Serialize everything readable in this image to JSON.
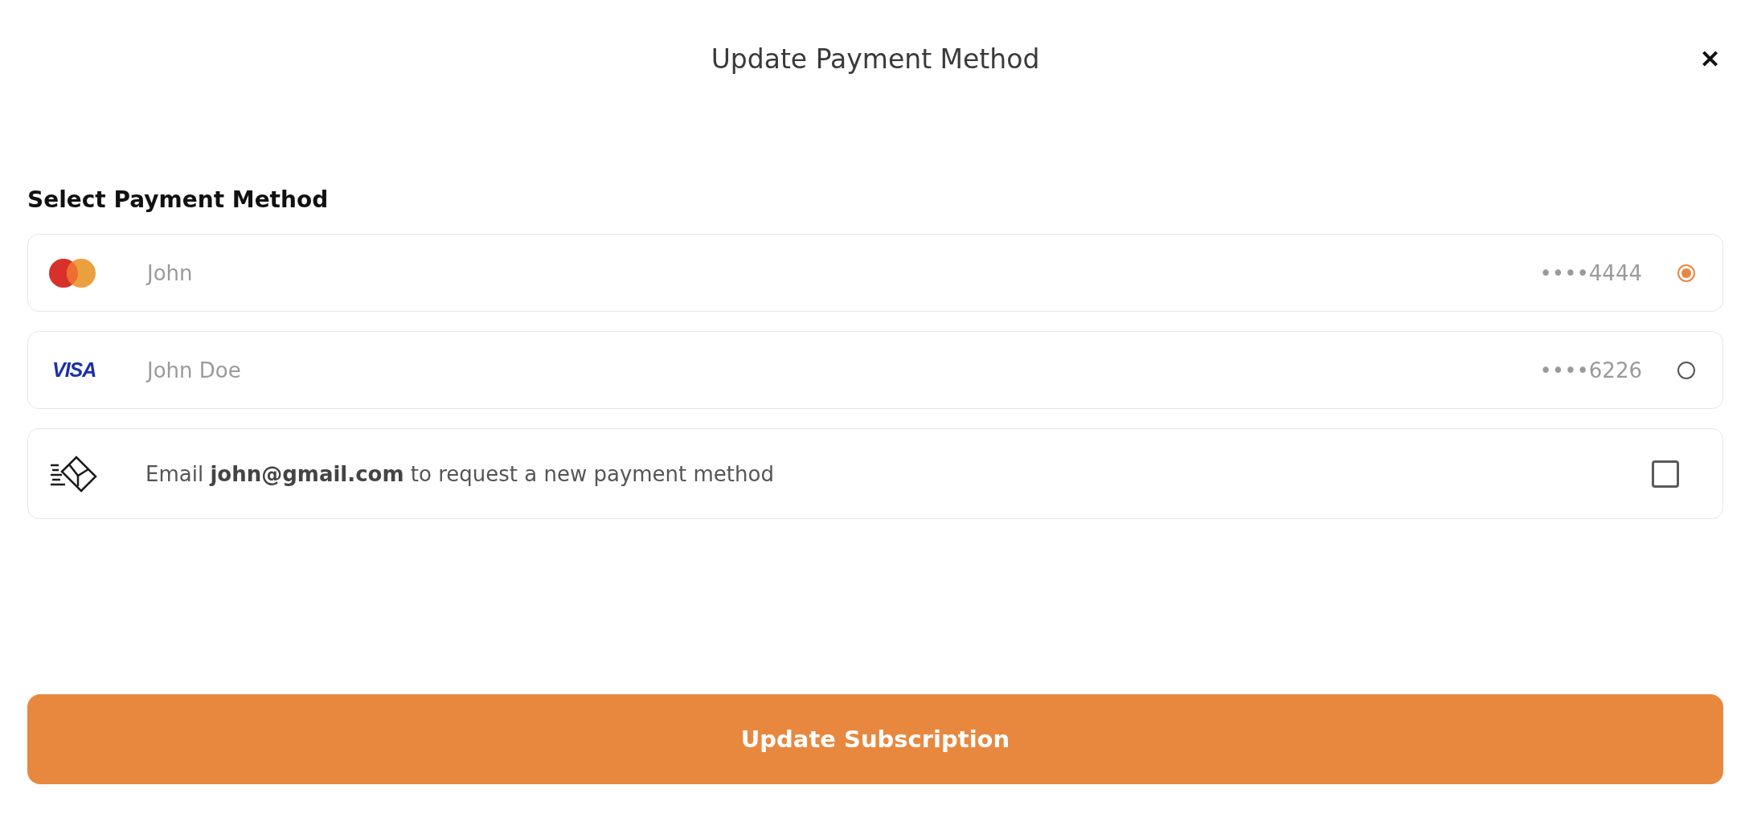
{
  "dialog": {
    "title": "Update Payment Method",
    "close_label": "✕"
  },
  "section_title": "Select Payment Method",
  "payment_methods": [
    {
      "kind": "mastercard",
      "name": "John",
      "number": "••••4444",
      "selected": true
    },
    {
      "kind": "visa",
      "logo_text": "VISA",
      "name": "John Doe",
      "number": "••••6226",
      "selected": false
    }
  ],
  "email_option": {
    "text": "Email **john@gmail.com** to request a new payment method",
    "checked": false
  },
  "submit_button": "Update Subscription"
}
